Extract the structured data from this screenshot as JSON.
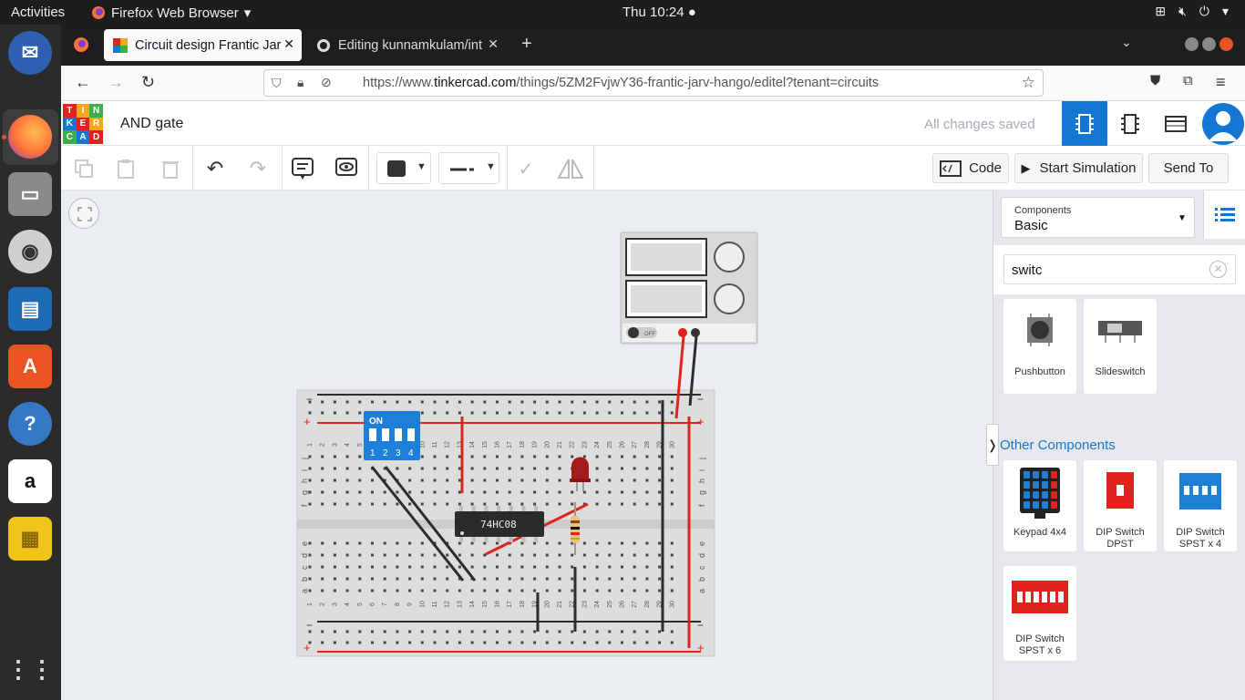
{
  "system": {
    "activities": "Activities",
    "app_menu": "Firefox Web Browser",
    "clock": "Thu 10:24"
  },
  "tabs": [
    {
      "title": "Circuit design Frantic Jar",
      "active": true
    },
    {
      "title": "Editing kunnamkulam/int",
      "active": false
    }
  ],
  "url": {
    "prefix": "https://www.",
    "domain": "tinkercad.com",
    "path": "/things/5ZM2FvjwY36-frantic-jarv-hango/editel?tenant=circuits"
  },
  "header": {
    "logo_letters": [
      "TIN",
      "KER",
      "CAD"
    ],
    "project_name": "AND gate",
    "save_status": "All changes saved"
  },
  "toolbar": {
    "code_label": "Code",
    "simulate_label": "Start Simulation",
    "send_label": "Send To"
  },
  "panel": {
    "components_label": "Components",
    "components_value": "Basic",
    "search_value": "switc",
    "section_title": "Other Components",
    "basic_items": [
      {
        "label": "Pushbutton"
      },
      {
        "label": "Slideswitch"
      }
    ],
    "other_items": [
      {
        "label": "Keypad 4x4"
      },
      {
        "label": "DIP Switch DPST"
      },
      {
        "label": "DIP Switch SPST x 4"
      },
      {
        "label": "DIP Switch SPST x 6"
      }
    ]
  },
  "circuit": {
    "chip_label": "74HC08",
    "dip_on": "ON",
    "dip_numbers": [
      "1",
      "2",
      "3",
      "4"
    ],
    "supply_off": "OFF",
    "rail_minus": "−",
    "rail_plus": "+",
    "row_letters_top": [
      "j",
      "i",
      "h",
      "g",
      "f"
    ],
    "row_letters_bottom": [
      "e",
      "d",
      "c",
      "b",
      "a"
    ],
    "column_numbers": [
      "1",
      "2",
      "3",
      "4",
      "5",
      "6",
      "7",
      "8",
      "9",
      "10",
      "11",
      "12",
      "13",
      "14",
      "15",
      "16",
      "17",
      "18",
      "19",
      "20",
      "21",
      "22",
      "23",
      "24",
      "25",
      "26",
      "27",
      "28",
      "29",
      "30"
    ]
  },
  "colors": {
    "tinkercad_blue": "#1477d1",
    "wire_red": "#e0231c",
    "wire_black": "#2c2c2c",
    "ubuntu_orange": "#e95420",
    "chip": "#2b2b2b"
  }
}
